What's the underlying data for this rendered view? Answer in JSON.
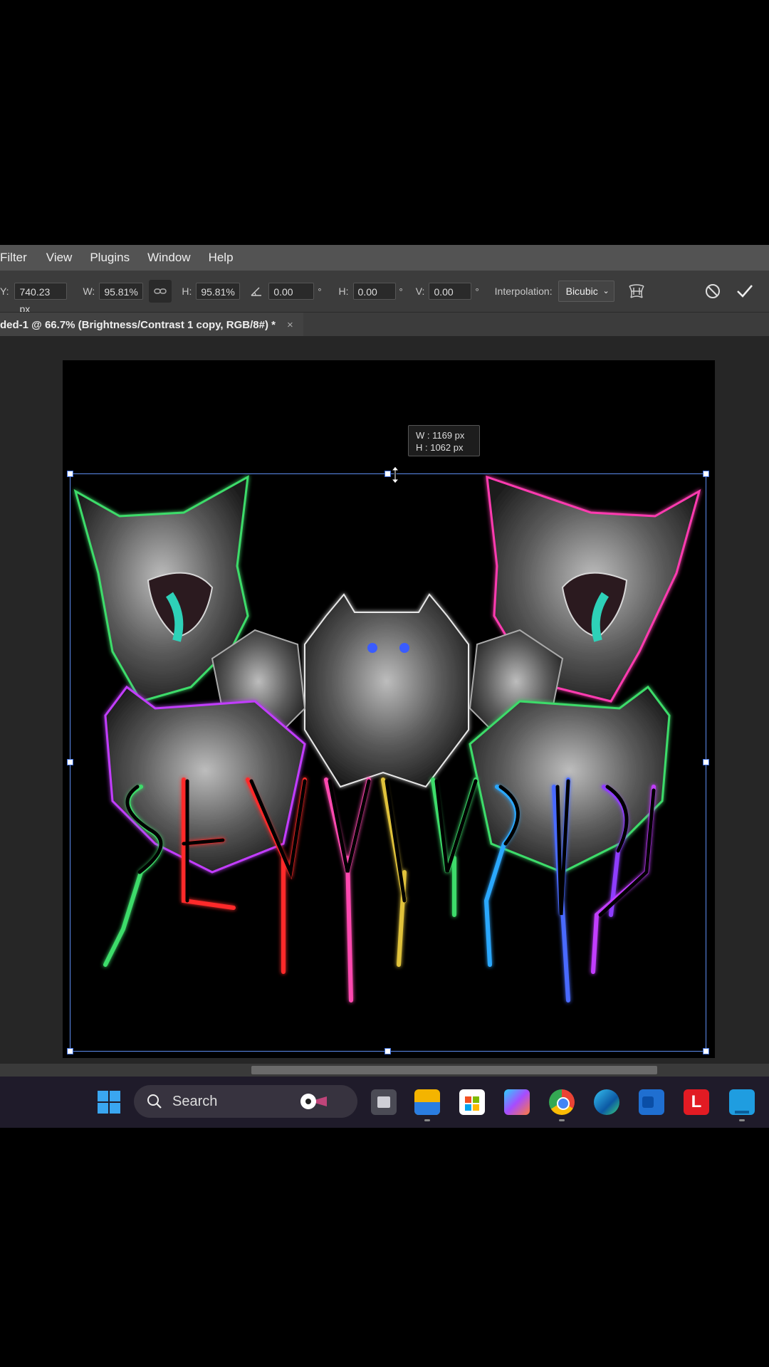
{
  "menu": [
    "Filter",
    "View",
    "Plugins",
    "Window",
    "Help"
  ],
  "options": {
    "y_label": "Y:",
    "y_value": "740.23 px",
    "w_label": "W:",
    "w_value": "95.81%",
    "h_label": "H:",
    "h_value": "95.81%",
    "angle_value": "0.00",
    "deg": "°",
    "skew_h_label": "H:",
    "skew_h_value": "0.00",
    "skew_v_label": "V:",
    "skew_v_value": "0.00",
    "interpolation_label": "Interpolation:",
    "interpolation_value": "Bicubic"
  },
  "document_tab": {
    "title": "ded-1 @ 66.7% (Brightness/Contrast 1 copy, RGB/8#) *",
    "close": "×"
  },
  "transform_tooltip": {
    "w": "W : 1169 px",
    "h": "H : 1062 px"
  },
  "artwork": {
    "text": "SEXUAL CATS",
    "description_icon": "neon-cats-artwork"
  },
  "taskbar": {
    "search_placeholder": "Search",
    "apps": [
      "task-view",
      "file-explorer",
      "microsoft-store",
      "copilot",
      "chrome",
      "edge",
      "outlook",
      "app-l",
      "app-blue"
    ],
    "badge_app_l": "L"
  },
  "colors": {
    "menubar": "#535353",
    "optionsbar": "#3c3c3c",
    "workspace": "#262626",
    "transform_border": "#5d8df0",
    "taskbar": "#1f1b2a"
  }
}
